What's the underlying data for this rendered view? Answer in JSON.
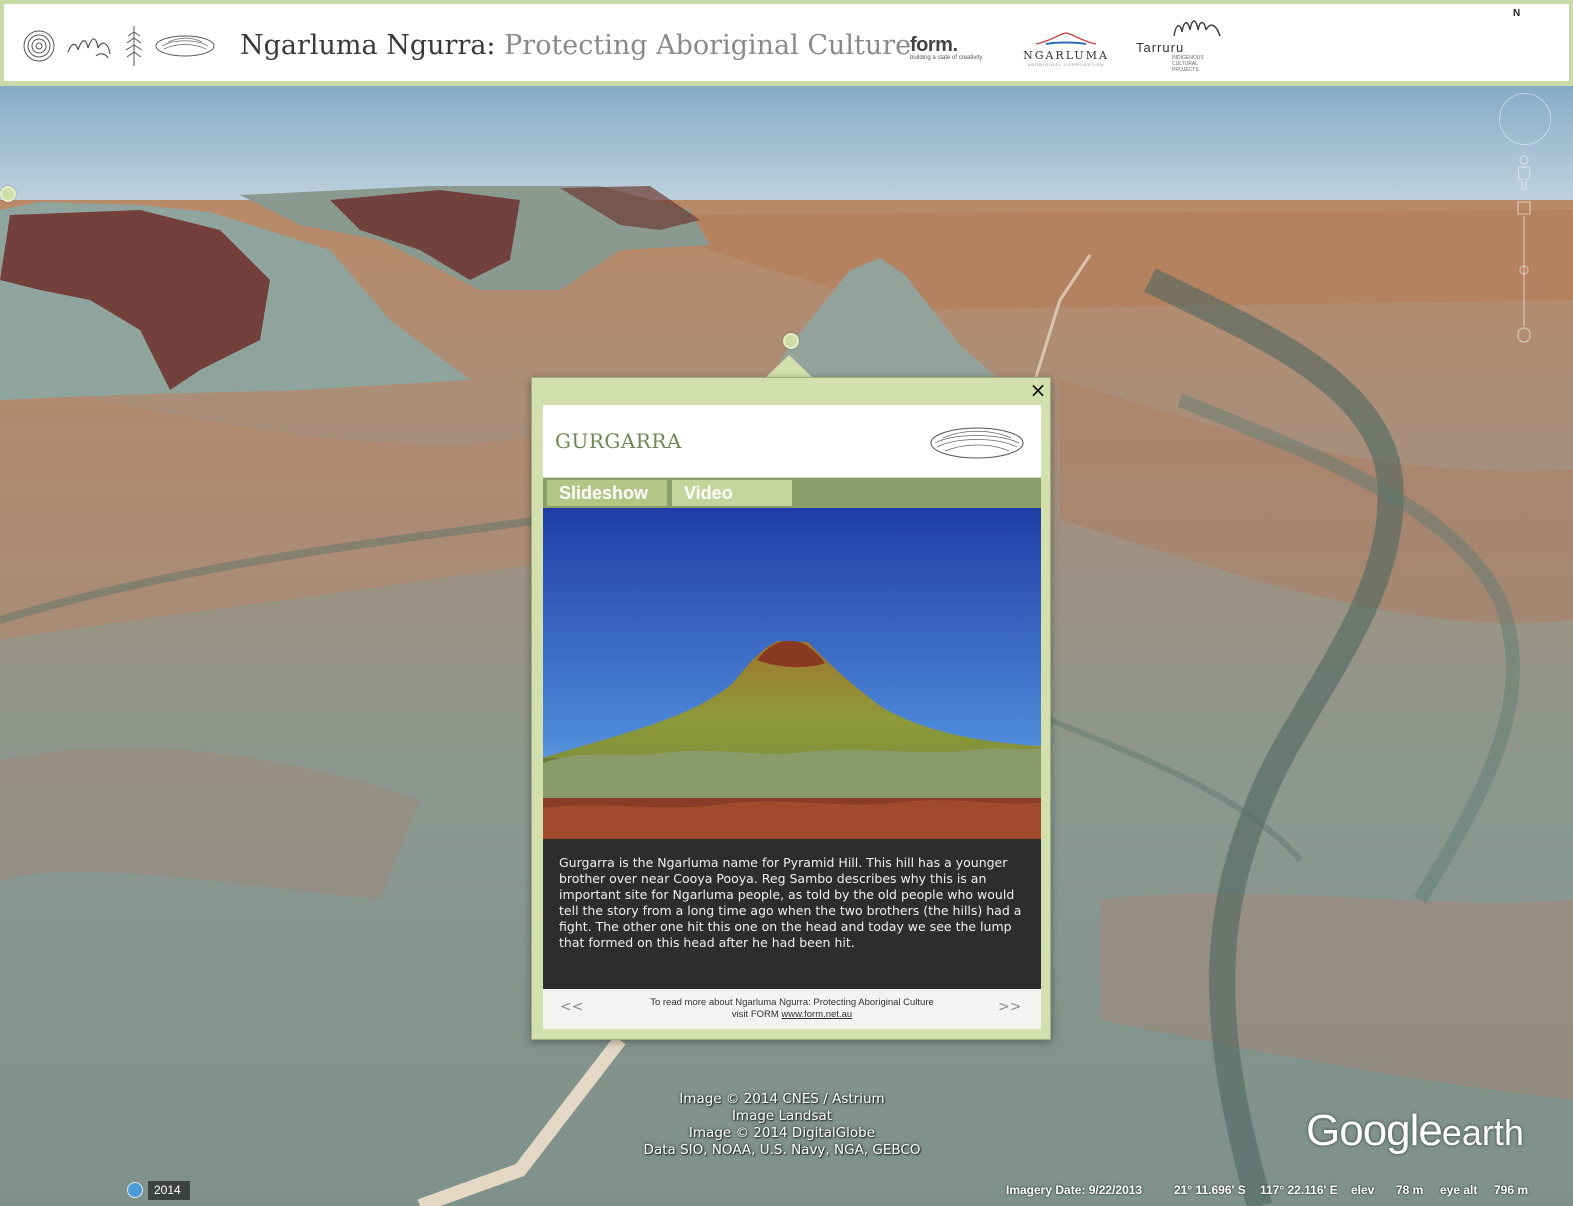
{
  "header": {
    "title_main": "Ngarluma Ngurra:",
    "title_sub": "Protecting Aboriginal Culture",
    "logos": {
      "form_name": "form.",
      "form_tagline": "building a state of creativity",
      "ngarluma_name": "NGARLUMA",
      "ngarluma_sub": "ABORIGINAL CORPORATION",
      "tarruru_name": "Tarruru",
      "tarruru_sub": "INDIGENOUS CULTURAL PROJECTS"
    },
    "compass_label": "N",
    "icons": [
      "spiral-icon",
      "hand-icon",
      "tree-icon",
      "stone-icon"
    ]
  },
  "balloon": {
    "title": "GURGARRA",
    "close_label": "×",
    "tabs": [
      {
        "label": "Slideshow",
        "active": true
      },
      {
        "label": "Video",
        "active": false
      }
    ],
    "caption": "Gurgarra is the Ngarluma name for Pyramid Hill. This hill has a younger brother over near Cooya Pooya. Reg Sambo describes why this is an important site for Ngarluma people, as told by the old people who would tell the story from a long time ago when the two brothers (the hills) had a fight. The other one hit this one on the head and today we see the lump that formed on this head after he had been hit.",
    "footer": {
      "prev_label": "<<",
      "next_label": ">>",
      "line1": "To read more about Ngarluma Ngurra: Protecting Aboriginal Culture",
      "line2_prefix": "visit FORM",
      "link_text": "www.form.net.au"
    }
  },
  "attribution": [
    "Image © 2014 CNES / Astrium",
    "Image Landsat",
    "Image © 2014 DigitalGlobe",
    "Data SIO, NOAA, U.S. Navy, NGA, GEBCO"
  ],
  "logo": {
    "google": "Google",
    "earth": "earth"
  },
  "status": {
    "year": "2014",
    "imagery_date": "Imagery Date: 9/22/2013",
    "lat": "21° 11.696' S",
    "lon": "117° 22.116' E",
    "elev_label": "elev",
    "elev_value": "78 m",
    "eye_label": "eye alt",
    "eye_value": "796 m"
  },
  "colors": {
    "header_border": "#c9d9a7",
    "balloon_bg": "#d3e0ad",
    "title_green": "#6f8754",
    "tab_bar": "#8a9e6c"
  }
}
